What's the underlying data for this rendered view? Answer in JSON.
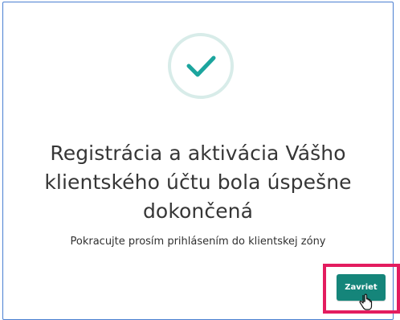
{
  "modal": {
    "title_line_1": "Registrácia a aktivácia Vášho",
    "title_line_2": "klientského účtu bola úspešne",
    "title_line_3": "dokončená",
    "message": "Pokracujte prosím prihlásením do klientskej zóny"
  },
  "actions": {
    "close_label": "Zavriet"
  },
  "icons": {
    "success": "check-icon",
    "cursor": "hand-pointer-icon"
  },
  "colors": {
    "accent": "#15857a",
    "check": "#1ca59e",
    "circle_ring": "#d8ece9",
    "highlight_border": "#e31c5f",
    "dialog_border": "#4a7fd1"
  }
}
